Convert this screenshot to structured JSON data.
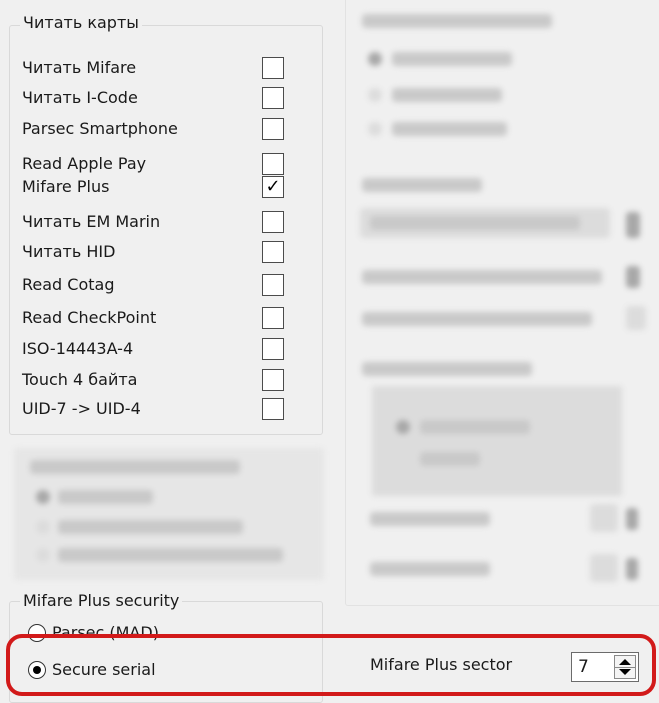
{
  "read_cards": {
    "title": "Читать карты",
    "items": [
      {
        "label": "Читать Mifare",
        "checked": false
      },
      {
        "label": "Читать I-Code",
        "checked": false
      },
      {
        "label": "Parsec Smartphone",
        "checked": false
      },
      {
        "label": "Read Apple Pay",
        "checked": false
      },
      {
        "label": "Mifare Plus",
        "checked": true
      },
      {
        "label": "Читать EM Marin",
        "checked": false
      },
      {
        "label": "Читать HID",
        "checked": false
      },
      {
        "label": "Read Cotag",
        "checked": false
      },
      {
        "label": "Read CheckPoint",
        "checked": false
      },
      {
        "label": "ISO-14443A-4",
        "checked": false
      },
      {
        "label": "Touch 4 байта",
        "checked": false
      },
      {
        "label": "UID-7 -> UID-4",
        "checked": false
      }
    ],
    "check_glyph": "✓"
  },
  "mifare_plus_security": {
    "title": "Mifare Plus security",
    "options": [
      {
        "label": "Parsec (MAD)",
        "selected": false
      },
      {
        "label": "Secure serial",
        "selected": true
      }
    ]
  },
  "sector": {
    "label": "Mifare Plus sector",
    "value": "7"
  },
  "colors": {
    "highlight": "#d21a1a"
  },
  "icons": {
    "checkbox_mark": "check-icon",
    "spin_up": "arrow-up-icon",
    "spin_down": "arrow-down-icon"
  }
}
